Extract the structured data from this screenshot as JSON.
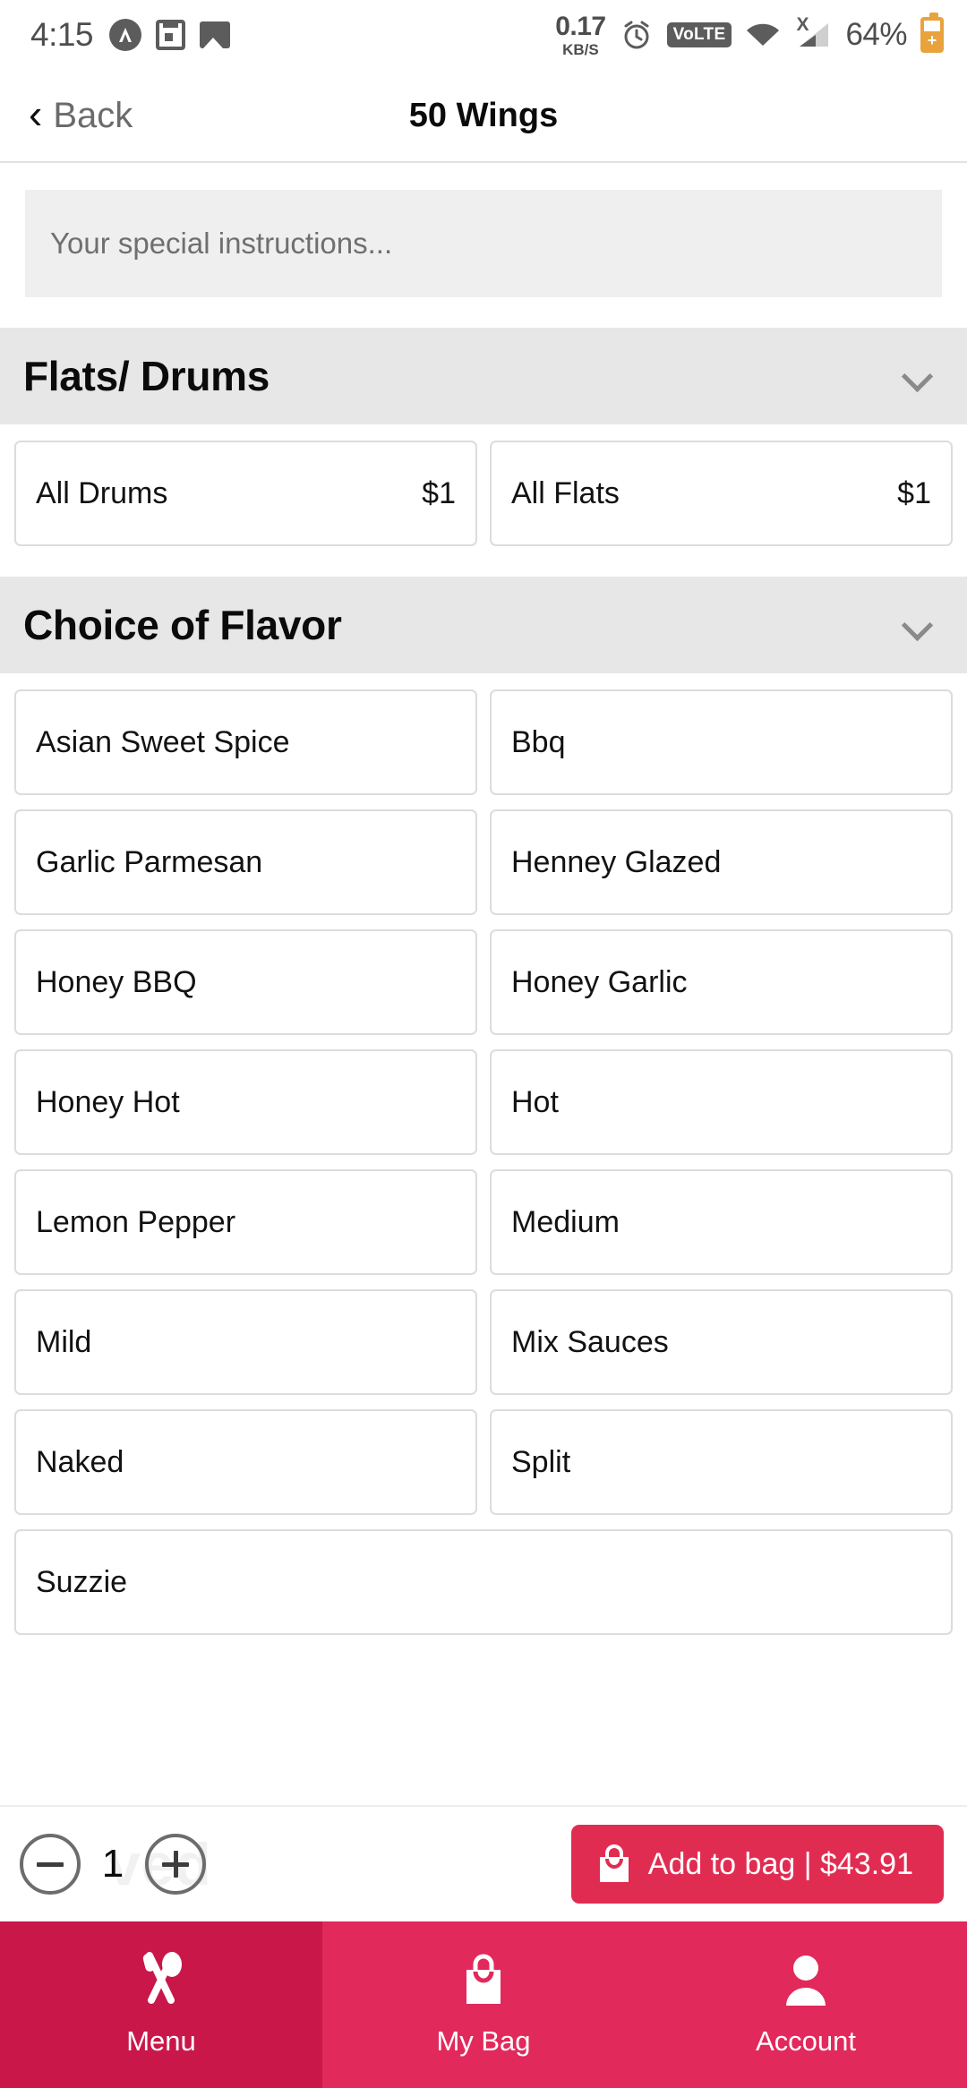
{
  "statusbar": {
    "time": "4:15",
    "network_speed_value": "0.17",
    "network_speed_unit": "KB/S",
    "volte_label": "VoLTE",
    "signal_x": "X",
    "battery_percent": "64%"
  },
  "appbar": {
    "back_label": "Back",
    "title": "50 Wings"
  },
  "instructions": {
    "placeholder": "Your special instructions...",
    "value": ""
  },
  "sections": [
    {
      "title": "Flats/ Drums",
      "options": [
        {
          "name": "All Drums",
          "price": "$1"
        },
        {
          "name": "All Flats",
          "price": "$1"
        }
      ]
    },
    {
      "title": "Choice of Flavor",
      "options": [
        {
          "name": "Asian Sweet Spice",
          "price": ""
        },
        {
          "name": "Bbq",
          "price": ""
        },
        {
          "name": "Garlic Parmesan",
          "price": ""
        },
        {
          "name": "Henney Glazed",
          "price": ""
        },
        {
          "name": "Honey BBQ",
          "price": ""
        },
        {
          "name": "Honey Garlic",
          "price": ""
        },
        {
          "name": "Honey Hot",
          "price": ""
        },
        {
          "name": "Hot",
          "price": ""
        },
        {
          "name": "Lemon Pepper",
          "price": ""
        },
        {
          "name": "Medium",
          "price": ""
        },
        {
          "name": "Mild",
          "price": ""
        },
        {
          "name": "Mix Sauces",
          "price": ""
        },
        {
          "name": "Naked",
          "price": ""
        },
        {
          "name": "Split",
          "price": ""
        },
        {
          "name": "Suzzie",
          "price": ""
        }
      ]
    }
  ],
  "actionbar": {
    "ghost_text": "ved",
    "decrement_label": "−",
    "increment_label": "+",
    "quantity": "1",
    "add_to_bag_label": "Add to bag  |  $43.91"
  },
  "tabbar": {
    "items": [
      {
        "label": "Menu",
        "icon": "cutlery-icon",
        "active": true
      },
      {
        "label": "My Bag",
        "icon": "bag-icon",
        "active": false
      },
      {
        "label": "Account",
        "icon": "person-icon",
        "active": false
      }
    ]
  },
  "colors": {
    "brand_primary": "#E12C52",
    "tabbar_bg": "#E2295B",
    "tab_active_bg": "#C9174A",
    "section_header_bg": "#e7e7e7",
    "input_bg": "#efefef",
    "card_border": "#dcdcdc"
  }
}
